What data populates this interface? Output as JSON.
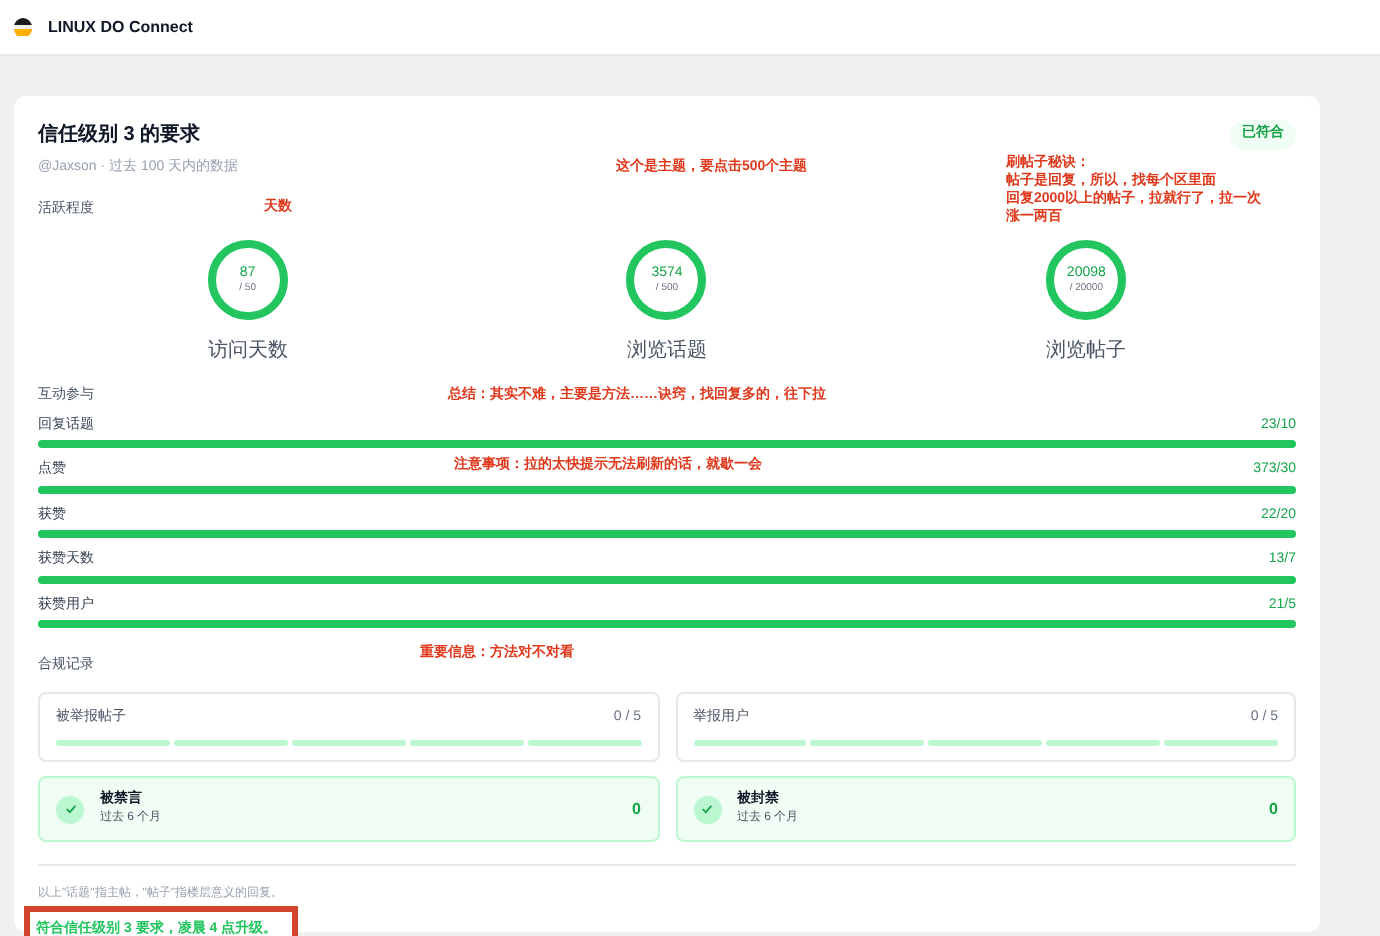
{
  "header": {
    "title": "LINUX DO Connect"
  },
  "card": {
    "title": "信任级别 3 的要求",
    "subtitle": "@Jaxson · 过去 100 天内的数据",
    "status_badge": "已符合"
  },
  "activity": {
    "label": "活跃程度",
    "rings": [
      {
        "value": "87",
        "target": "/ 50",
        "label": "访问天数",
        "level": 1
      },
      {
        "value": "3574",
        "target": "/ 500",
        "label": "浏览话题",
        "level": 1
      },
      {
        "value": "20098",
        "target": "/ 20000",
        "label": "浏览帖子",
        "level": 1
      }
    ]
  },
  "interaction": {
    "label": "互动参与",
    "bars": [
      {
        "label": "回复话题",
        "reading": "23/10",
        "level": 1
      },
      {
        "label": "点赞",
        "reading": "373/30",
        "level": 1
      },
      {
        "label": "获赞",
        "reading": "22/20",
        "level": 1
      },
      {
        "label": "获赞天数",
        "reading": "13/7",
        "level": 1
      },
      {
        "label": "获赞用户",
        "reading": "21/5",
        "level": 1
      }
    ]
  },
  "compliance": {
    "label": "合规记录",
    "reports": [
      {
        "label": "被举报帖子",
        "reading": "0 / 5"
      },
      {
        "label": "举报用户",
        "reading": "0 / 5"
      }
    ],
    "penalties": [
      {
        "title": "被禁言",
        "subtitle": "过去 6 个月",
        "value": "0",
        "ok": true
      },
      {
        "title": "被封禁",
        "subtitle": "过去 6 个月",
        "value": "0",
        "ok": true
      }
    ]
  },
  "footnote": "以上\"话题\"指主帖，\"帖子\"指楼层意义的回复。",
  "result": {
    "text": "符合信任级别 3 要求，凌晨 4 点升级。",
    "highlighted": true
  },
  "annotations": [
    {
      "lines": [
        "天数"
      ]
    },
    {
      "lines": [
        "这个是主题，要点击500个主题"
      ]
    },
    {
      "lines": [
        "刷帖子秘诀：",
        "帖子是回复，所以，找每个区里面",
        "回复2000以上的帖子，拉就行了，拉一次",
        "涨一两百"
      ]
    },
    {
      "lines": [
        "总结：其实不难，主要是方法……诀窍，找回复多的，往下拉"
      ]
    },
    {
      "lines": [
        "注意事项：拉的太快提示无法刷新的话，就歇一会"
      ]
    },
    {
      "lines": [
        "重要信息：方法对不对看"
      ]
    }
  ]
}
